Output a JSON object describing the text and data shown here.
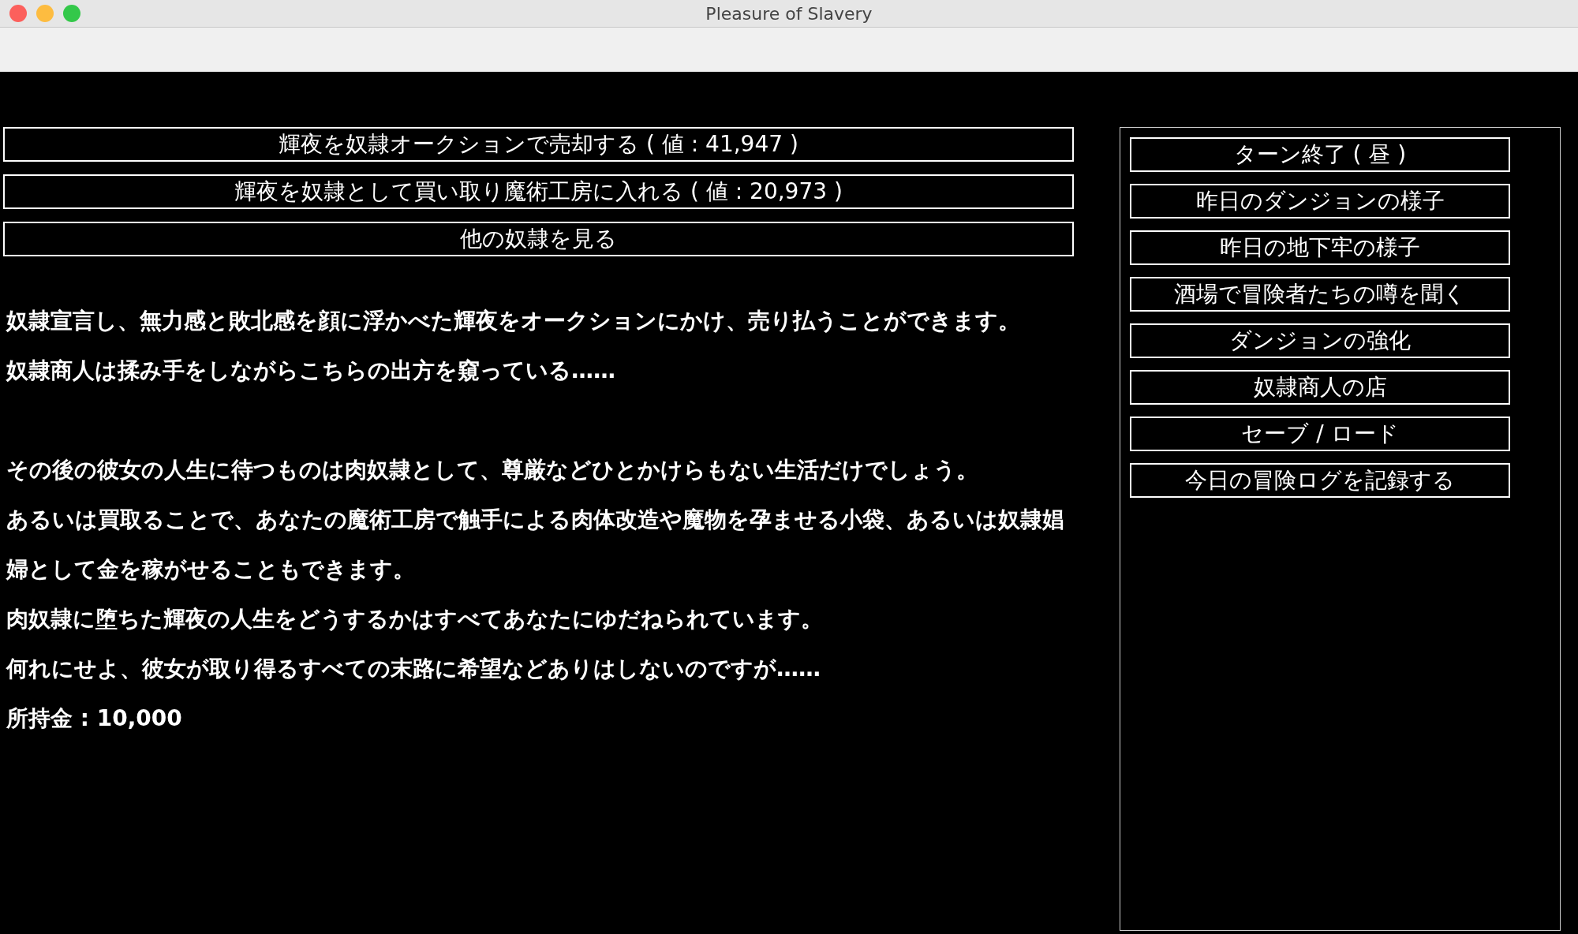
{
  "window": {
    "title": "Pleasure of Slavery"
  },
  "actions": [
    {
      "label": "輝夜を奴隷オークションで売却する ( 値 : 41,947 )"
    },
    {
      "label": "輝夜を奴隷として買い取り魔術工房に入れる ( 値 : 20,973 )"
    },
    {
      "label": "他の奴隷を見る"
    }
  ],
  "sections": [
    [
      "奴隷宣言し、無力感と敗北感を顔に浮かべた輝夜をオークションにかけ、売り払うことができます。",
      "奴隷商人は揉み手をしながらこちらの出方を窺っている……"
    ],
    [
      "その後の彼女の人生に待つものは肉奴隷として、尊厳などひとかけらもない生活だけでしょう。",
      "あるいは買取ることで、あなたの魔術工房で触手による肉体改造や魔物を孕ませる小袋、あるいは奴隷娼婦として金を稼がせることもできます。",
      "肉奴隷に堕ちた輝夜の人生をどうするかはすべてあなたにゆだねられています。",
      "何れにせよ、彼女が取り得るすべての末路に希望などありはしないのですが……",
      "所持金 : 10,000"
    ]
  ],
  "menu": [
    {
      "label": "ターン終了 ( 昼 )"
    },
    {
      "label": "昨日のダンジョンの様子"
    },
    {
      "label": "昨日の地下牢の様子"
    },
    {
      "label": "酒場で冒険者たちの噂を聞く"
    },
    {
      "label": "ダンジョンの強化"
    },
    {
      "label": "奴隷商人の店"
    },
    {
      "label": "セーブ / ロード"
    },
    {
      "label": "今日の冒険ログを記録する"
    }
  ]
}
